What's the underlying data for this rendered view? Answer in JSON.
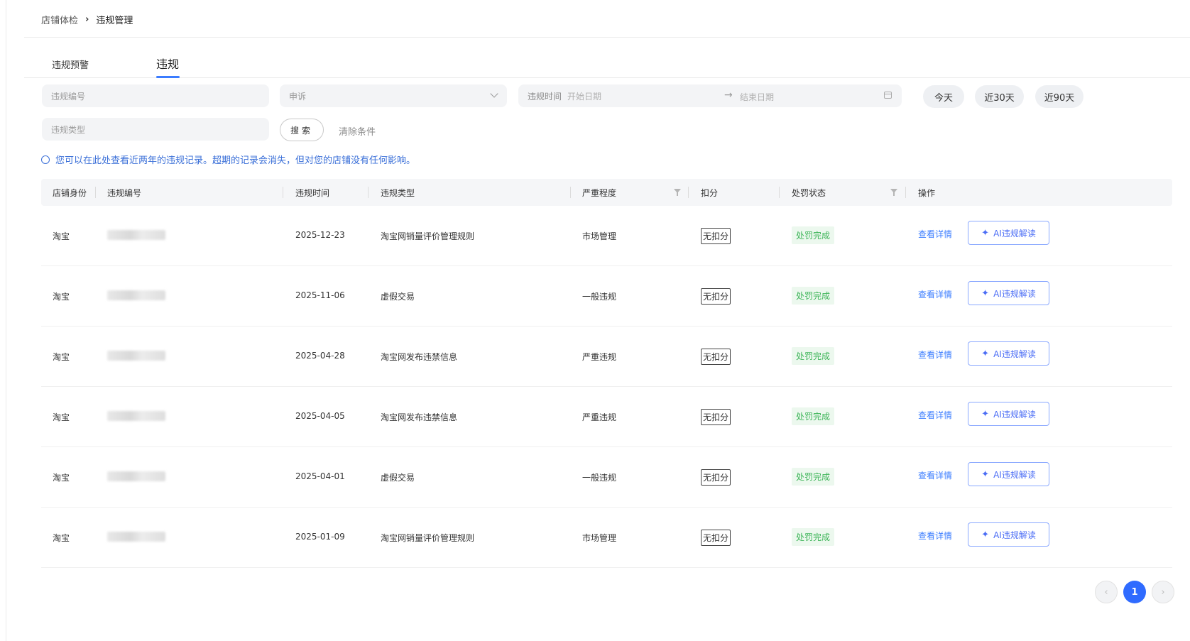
{
  "breadcrumb": {
    "parent": "店铺体检",
    "separator": "›",
    "current": "违规管理"
  },
  "tabs": [
    {
      "label": "违规预警"
    },
    {
      "label": "违规"
    }
  ],
  "filters": {
    "violation_id_placeholder": "违规编号",
    "appeal_placeholder": "申诉",
    "date_label": "违规时间",
    "start_placeholder": "开始日期",
    "date_arrow": "→",
    "end_placeholder": "结束日期",
    "violation_type_placeholder": "违规类型",
    "quick_today": "今天",
    "quick_30": "近30天",
    "quick_90": "近90天",
    "search": "搜索",
    "clear": "清除条件"
  },
  "notice": "您可以在此处查看近两年的违规记录。超期的记录会消失，但对您的店铺没有任何影响。",
  "table": {
    "headers": [
      "店铺身份",
      "违规编号",
      "违规时间",
      "违规类型",
      "严重程度",
      "扣分",
      "处罚状态",
      "操作"
    ],
    "rows": [
      {
        "shop": "淘宝",
        "date": "2025-12-23",
        "type": "淘宝网销量评价管理规则",
        "severity": "市场管理",
        "score": "无扣分",
        "status": "处罚完成",
        "detail": "查看详情",
        "ai": "AI违规解读"
      },
      {
        "shop": "淘宝",
        "date": "2025-11-06",
        "type": "虚假交易",
        "severity": "一般违规",
        "score": "无扣分",
        "status": "处罚完成",
        "detail": "查看详情",
        "ai": "AI违规解读"
      },
      {
        "shop": "淘宝",
        "date": "2025-04-28",
        "type": "淘宝网发布违禁信息",
        "severity": "严重违规",
        "score": "无扣分",
        "status": "处罚完成",
        "detail": "查看详情",
        "ai": "AI违规解读"
      },
      {
        "shop": "淘宝",
        "date": "2025-04-05",
        "type": "淘宝网发布违禁信息",
        "severity": "严重违规",
        "score": "无扣分",
        "status": "处罚完成",
        "detail": "查看详情",
        "ai": "AI违规解读"
      },
      {
        "shop": "淘宝",
        "date": "2025-04-01",
        "type": "虚假交易",
        "severity": "一般违规",
        "score": "无扣分",
        "status": "处罚完成",
        "detail": "查看详情",
        "ai": "AI违规解读"
      },
      {
        "shop": "淘宝",
        "date": "2025-01-09",
        "type": "淘宝网销量评价管理规则",
        "severity": "市场管理",
        "score": "无扣分",
        "status": "处罚完成",
        "detail": "查看详情",
        "ai": "AI违规解读"
      }
    ]
  },
  "pagination": {
    "prev": "‹",
    "current": "1",
    "next": "›"
  },
  "colors": {
    "accent": "#3b7cff",
    "status_green": "#3db558",
    "ai_purple": "#4c6ef5"
  },
  "icons": {
    "ai": "sparkle-icon",
    "calendar": "calendar-icon",
    "chevron": "chevron-down-icon",
    "filter": "filter-icon",
    "info": "info-icon"
  }
}
